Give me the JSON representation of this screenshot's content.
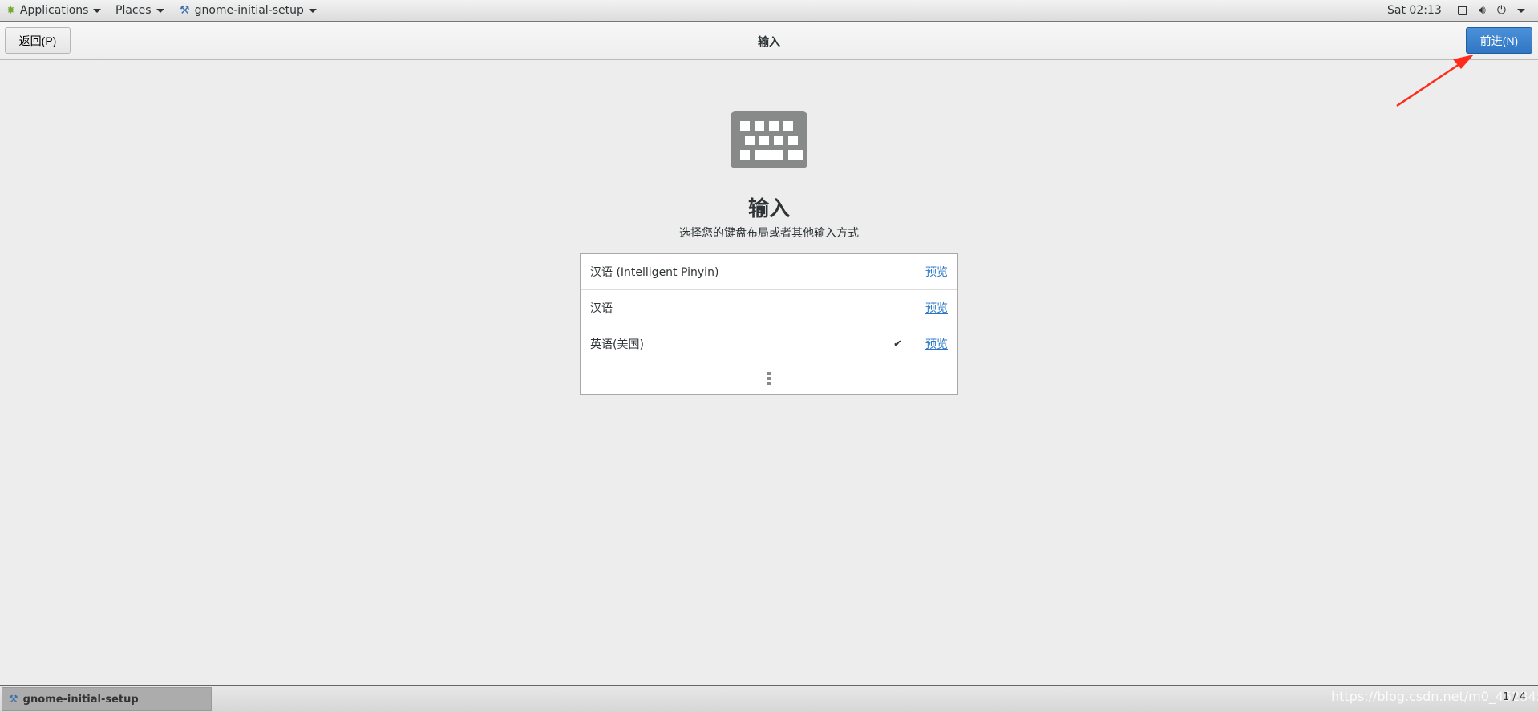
{
  "topbar": {
    "applications": "Applications",
    "places": "Places",
    "window": "gnome-initial-setup",
    "clock": "Sat 02:13",
    "icons": [
      "display-icon",
      "volume-icon",
      "power-icon"
    ]
  },
  "header": {
    "back": "返回(P)",
    "title": "输入",
    "next": "前进(N)"
  },
  "page": {
    "title": "输入",
    "subtitle": "选择您的键盘布局或者其他输入方式"
  },
  "inputs": [
    {
      "name": "汉语 (Intelligent Pinyin)",
      "selected": false,
      "preview": "预览"
    },
    {
      "name": "汉语",
      "selected": false,
      "preview": "预览"
    },
    {
      "name": "英语(美国)",
      "selected": true,
      "preview": "预览"
    }
  ],
  "taskbar": {
    "task": "gnome-initial-setup",
    "pager": "1 / 4",
    "watermark": "https://blog.csdn.net/m0_45234510"
  },
  "colors": {
    "accent": "#3a80cf",
    "annotation_arrow": "#ff2a1a"
  }
}
